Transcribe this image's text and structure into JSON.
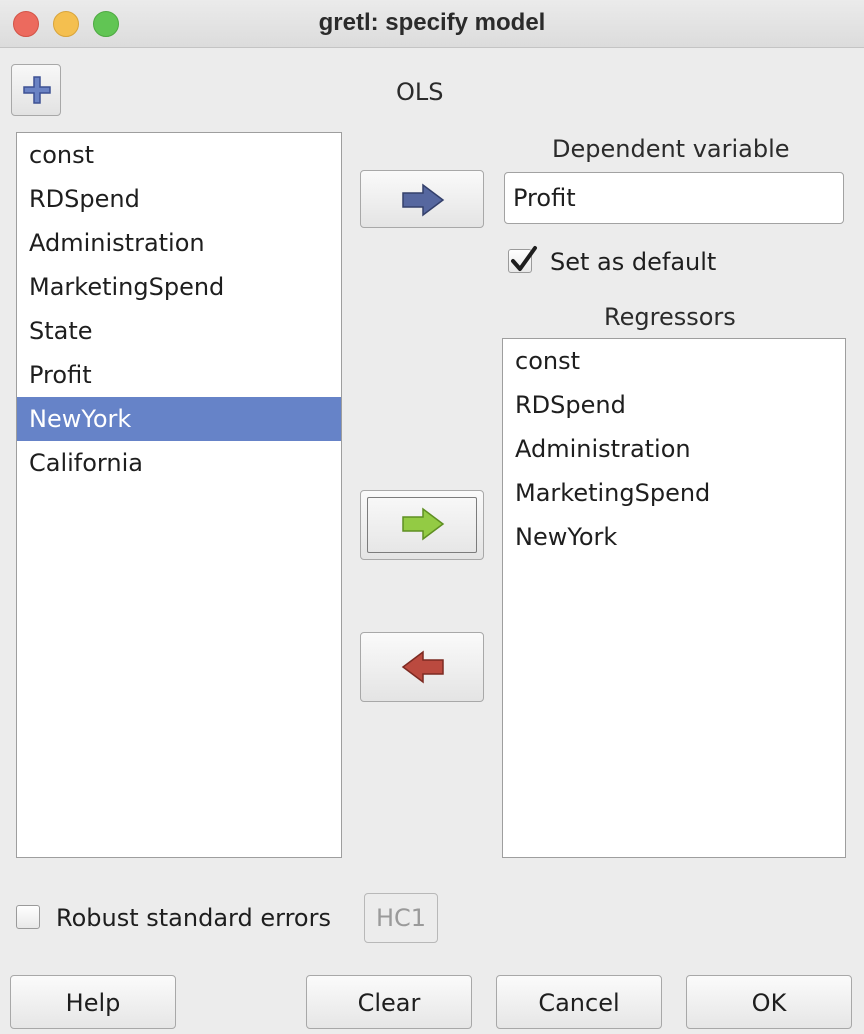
{
  "window": {
    "title": "gretl: specify model"
  },
  "toolbar": {
    "add_icon": "plus-icon"
  },
  "model": {
    "label": "OLS"
  },
  "available_variables": [
    {
      "label": "const",
      "selected": false
    },
    {
      "label": "RDSpend",
      "selected": false
    },
    {
      "label": "Administration",
      "selected": false
    },
    {
      "label": "MarketingSpend",
      "selected": false
    },
    {
      "label": "State",
      "selected": false
    },
    {
      "label": "Profit",
      "selected": false
    },
    {
      "label": "NewYork",
      "selected": true
    },
    {
      "label": "California",
      "selected": false
    }
  ],
  "dependent": {
    "label": "Dependent variable",
    "value": "Profit",
    "set_default_label": "Set as default",
    "set_default_checked": true
  },
  "regressors": {
    "label": "Regressors",
    "items": [
      "const",
      "RDSpend",
      "Administration",
      "MarketingSpend",
      "NewYork"
    ]
  },
  "arrows": {
    "dependent_icon": "arrow-right-icon",
    "add_icon": "arrow-right-icon",
    "remove_icon": "arrow-left-icon",
    "dependent_color": "#4e5f96",
    "add_color": "#8cc63f",
    "remove_color": "#b8453a"
  },
  "options": {
    "robust_label": "Robust standard errors",
    "robust_checked": false,
    "hc_label": "HC1"
  },
  "buttons": {
    "help": "Help",
    "clear": "Clear",
    "cancel": "Cancel",
    "ok": "OK"
  },
  "colors": {
    "selection": "#6683c8",
    "window_bg": "#ececec"
  }
}
